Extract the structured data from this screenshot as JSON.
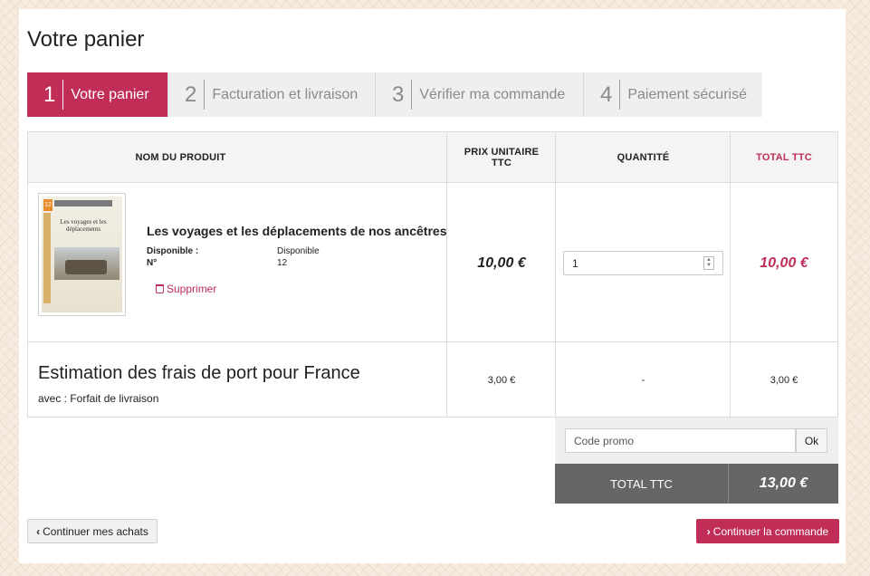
{
  "page_title": "Votre panier",
  "steps": [
    {
      "num": "1",
      "label": "Votre panier"
    },
    {
      "num": "2",
      "label": "Facturation et livraison"
    },
    {
      "num": "3",
      "label": "Vérifier ma commande"
    },
    {
      "num": "4",
      "label": "Paiement sécurisé"
    }
  ],
  "table": {
    "headers": {
      "product": "NOM DU PRODUIT",
      "unit_price": "PRIX UNITAIRE TTC",
      "quantity": "QUANTITÉ",
      "total": "TOTAL TTC"
    },
    "item": {
      "name": "Les voyages et les déplacements de nos ancêtres",
      "meta": [
        {
          "key": "Disponible :",
          "value": "Disponible"
        },
        {
          "key": "N°",
          "value": "12"
        }
      ],
      "delete_label": "Supprimer",
      "unit_price": "10,00 €",
      "quantity": "1",
      "total": "10,00 €",
      "cover": {
        "number": "12",
        "title": "Les voyages et les déplacements"
      }
    },
    "shipping": {
      "title": "Estimation des frais de port pour France",
      "subtitle": "avec : Forfait de livraison",
      "unit_price": "3,00 €",
      "quantity": "-",
      "total": "3,00 €"
    }
  },
  "promo": {
    "placeholder": "Code promo",
    "ok_label": "Ok"
  },
  "grand_total": {
    "label": "TOTAL TTC",
    "value": "13,00 €"
  },
  "buttons": {
    "continue_shopping": "Continuer mes achats",
    "continue_order": "Continuer la commande"
  },
  "colors": {
    "accent": "#c02e57",
    "total_bar": "#666666"
  }
}
